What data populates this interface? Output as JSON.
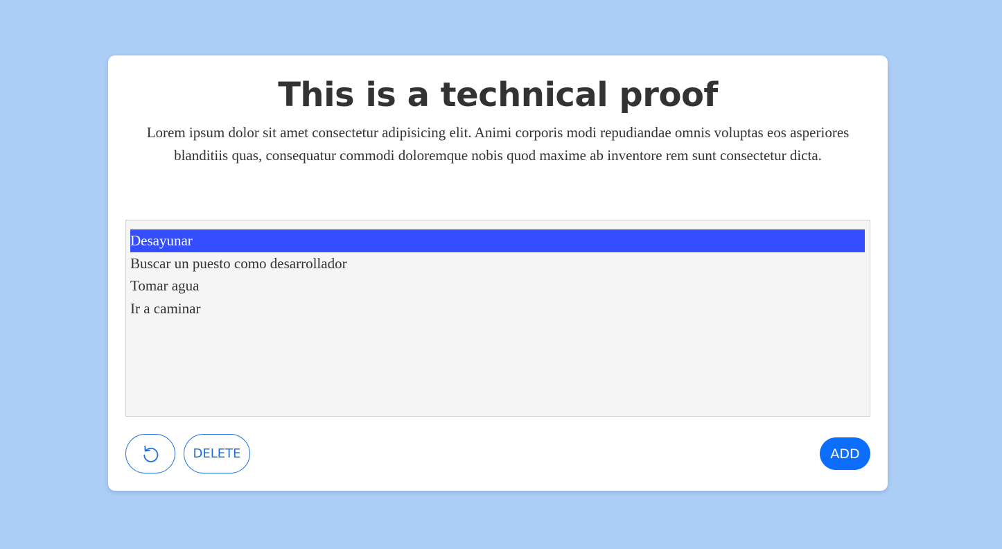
{
  "page": {
    "background_color": "#abcdf6"
  },
  "card": {
    "title": "This is a technical proof",
    "description": "Lorem ipsum dolor sit amet consectetur adipisicing elit. Animi corporis modi repudiandae omnis voluptas eos asperiores blanditiis quas, consequatur commodi doloremque nobis quod maxime ab inventore rem sunt consectetur dicta."
  },
  "list": {
    "selected_index": 0,
    "selected_color": "#334dff",
    "items": [
      "Desayunar",
      "Buscar un puesto como desarrollador",
      "Tomar agua",
      "Ir a caminar"
    ]
  },
  "buttons": {
    "undo_icon": "undo-icon",
    "delete_label": "DELETE",
    "add_label": "ADD",
    "accent_color": "#0d6efd"
  }
}
